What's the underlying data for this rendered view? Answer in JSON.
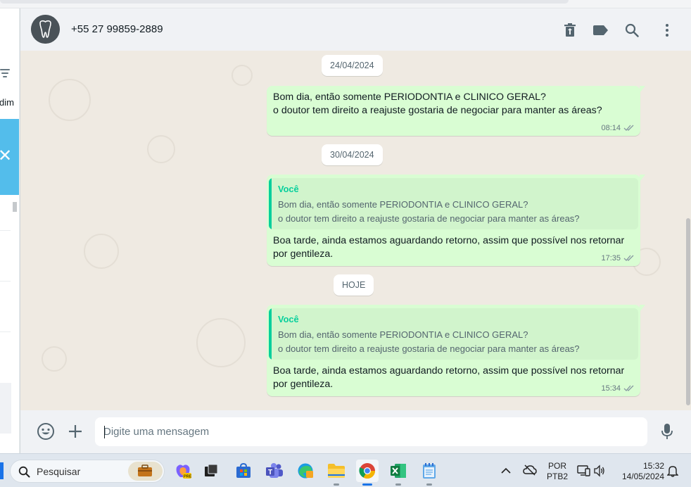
{
  "sidebar_fragment": {
    "cut_label": "dim"
  },
  "header": {
    "contact": "+55 27 99859-2889",
    "icons": [
      "trash-icon",
      "label-icon",
      "search-icon",
      "menu-icon"
    ]
  },
  "messages": {
    "date1": "24/04/2024",
    "msg1": {
      "line1": "Bom dia, então somente PERIODONTIA e CLINICO GERAL?",
      "line2": "o doutor tem direito a reajuste gostaria de negociar para manter as áreas?",
      "time": "08:14"
    },
    "date2": "30/04/2024",
    "msg2": {
      "quote_author": "Você",
      "quote_line1": "Bom dia, então somente PERIODONTIA e CLINICO GERAL?",
      "quote_line2": "o doutor tem direito a reajuste gostaria de negociar para manter as áreas?",
      "line1": "Boa tarde, ainda estamos aguardando retorno, assim que possível nos retornar",
      "line2": "por gentileza.",
      "time": "17:35"
    },
    "date3": "HOJE",
    "msg3": {
      "quote_author": "Você",
      "quote_line1": "Bom dia, então somente PERIODONTIA e CLINICO GERAL?",
      "quote_line2": "o doutor tem direito a reajuste gostaria de negociar para manter as áreas?",
      "line1": "Boa tarde, ainda estamos aguardando retorno, assim que possível nos retornar",
      "line2": "por gentileza.",
      "time": "15:34"
    }
  },
  "composer": {
    "placeholder": "Digite uma mensagem"
  },
  "taskbar": {
    "search_label": "Pesquisar",
    "language": "POR",
    "layout": "PTB2",
    "time": "15:32",
    "date": "14/05/2024"
  },
  "colors": {
    "bubble_out": "#d9fdd3",
    "quote_accent": "#06cf9c",
    "chat_bg": "#efeae2",
    "header_bg": "#f0f2f5"
  }
}
